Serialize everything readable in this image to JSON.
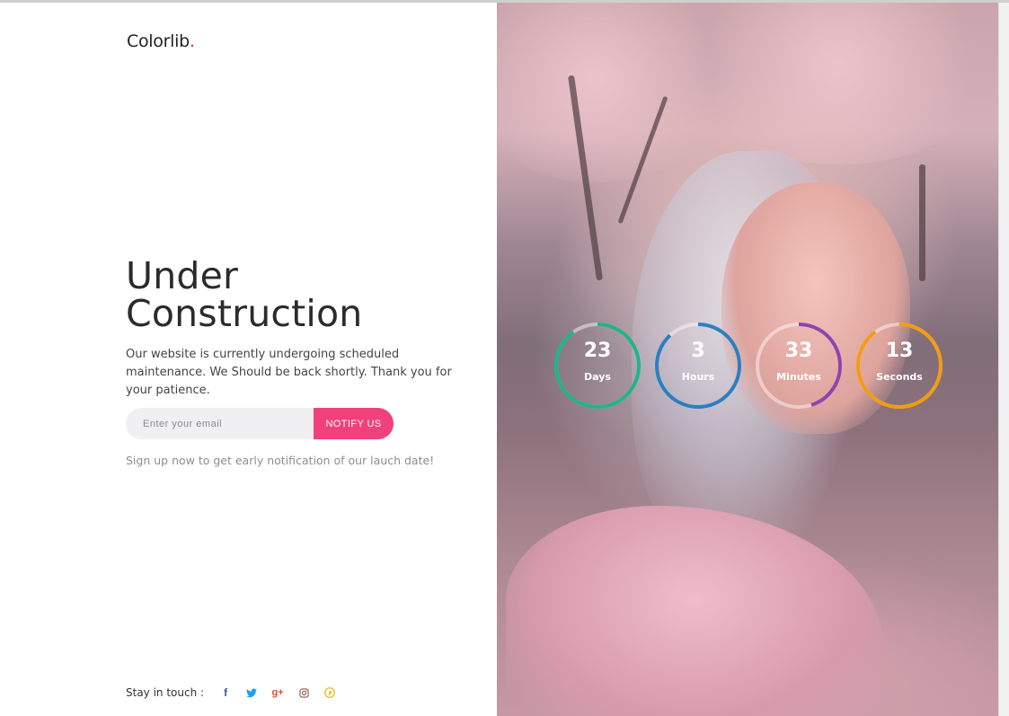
{
  "brand": {
    "name": "Colorlib",
    "dot": ".",
    "dot_color": "#e91e63"
  },
  "hero": {
    "title_line1": "Under",
    "title_line2": "Construction",
    "description": "Our website is currently undergoing scheduled maintenance. We Should be back shortly. Thank you for your patience."
  },
  "subscribe": {
    "placeholder": "Enter your email",
    "button_label": "NOTIFY US",
    "button_color": "#f0417a",
    "note": "Sign up now to get early notification of our lauch date!"
  },
  "social": {
    "label": "Stay in touch :",
    "icons": [
      "facebook-icon",
      "twitter-icon",
      "google-plus-icon",
      "instagram-icon",
      "pinterest-icon"
    ],
    "facebook_glyph": "f",
    "google_plus_glyph": "g+"
  },
  "countdown": [
    {
      "value": "23",
      "unit": "Days",
      "color": "#1fb48a",
      "progress": 0.9
    },
    {
      "value": "3",
      "unit": "Hours",
      "color": "#2b7fc1",
      "progress": 0.88
    },
    {
      "value": "33",
      "unit": "Minutes",
      "color": "#8e44ad",
      "progress": 0.45
    },
    {
      "value": "13",
      "unit": "Seconds",
      "color": "#f39c12",
      "progress": 0.9
    }
  ]
}
